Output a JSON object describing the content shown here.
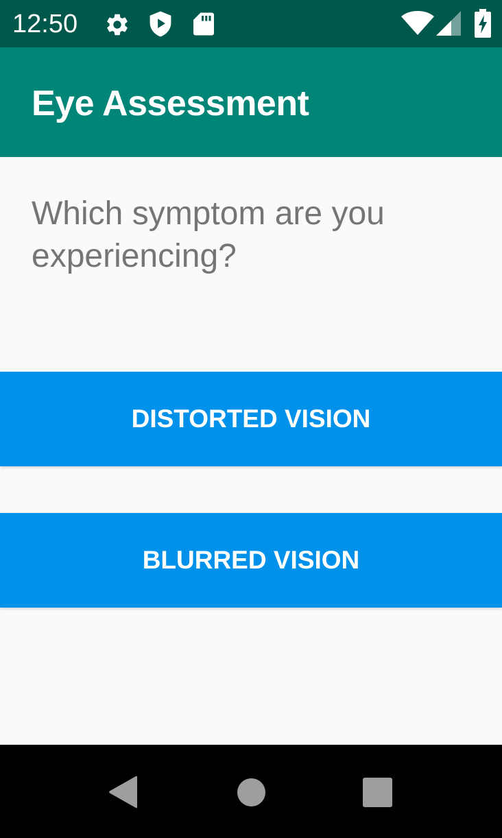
{
  "status_bar": {
    "time": "12:50",
    "icons": [
      "settings-icon",
      "shield-play-icon",
      "sd-card-icon",
      "wifi-icon",
      "cellular-signal-icon",
      "battery-charging-icon"
    ]
  },
  "app_bar": {
    "title": "Eye Assessment"
  },
  "main": {
    "question": "Which symptom are you experiencing?",
    "options": [
      {
        "label": "DISTORTED VISION"
      },
      {
        "label": "BLURRED VISION"
      }
    ]
  },
  "nav_bar": {
    "buttons": [
      "back-icon",
      "home-icon",
      "recents-icon"
    ]
  },
  "colors": {
    "status_bar": "#00574b",
    "app_bar": "#008577",
    "button": "#0091ea",
    "background": "#fafafa",
    "question_text": "#757575"
  }
}
